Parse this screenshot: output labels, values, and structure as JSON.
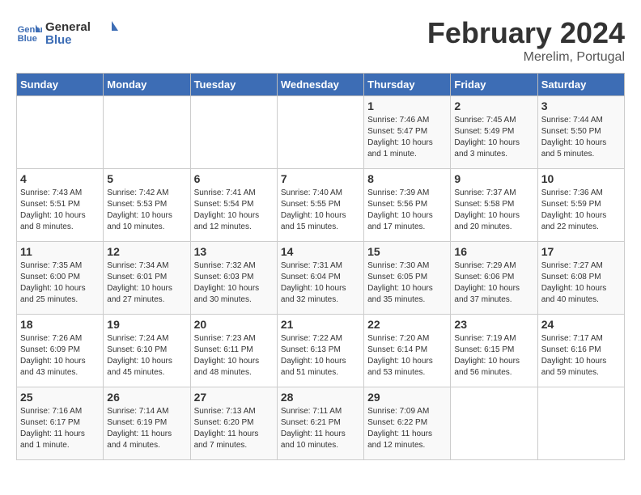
{
  "header": {
    "logo_general": "General",
    "logo_blue": "Blue",
    "month_title": "February 2024",
    "subtitle": "Merelim, Portugal"
  },
  "days_of_week": [
    "Sunday",
    "Monday",
    "Tuesday",
    "Wednesday",
    "Thursday",
    "Friday",
    "Saturday"
  ],
  "weeks": [
    [
      {
        "day": "",
        "info": ""
      },
      {
        "day": "",
        "info": ""
      },
      {
        "day": "",
        "info": ""
      },
      {
        "day": "",
        "info": ""
      },
      {
        "day": "1",
        "info": "Sunrise: 7:46 AM\nSunset: 5:47 PM\nDaylight: 10 hours\nand 1 minute."
      },
      {
        "day": "2",
        "info": "Sunrise: 7:45 AM\nSunset: 5:49 PM\nDaylight: 10 hours\nand 3 minutes."
      },
      {
        "day": "3",
        "info": "Sunrise: 7:44 AM\nSunset: 5:50 PM\nDaylight: 10 hours\nand 5 minutes."
      }
    ],
    [
      {
        "day": "4",
        "info": "Sunrise: 7:43 AM\nSunset: 5:51 PM\nDaylight: 10 hours\nand 8 minutes."
      },
      {
        "day": "5",
        "info": "Sunrise: 7:42 AM\nSunset: 5:53 PM\nDaylight: 10 hours\nand 10 minutes."
      },
      {
        "day": "6",
        "info": "Sunrise: 7:41 AM\nSunset: 5:54 PM\nDaylight: 10 hours\nand 12 minutes."
      },
      {
        "day": "7",
        "info": "Sunrise: 7:40 AM\nSunset: 5:55 PM\nDaylight: 10 hours\nand 15 minutes."
      },
      {
        "day": "8",
        "info": "Sunrise: 7:39 AM\nSunset: 5:56 PM\nDaylight: 10 hours\nand 17 minutes."
      },
      {
        "day": "9",
        "info": "Sunrise: 7:37 AM\nSunset: 5:58 PM\nDaylight: 10 hours\nand 20 minutes."
      },
      {
        "day": "10",
        "info": "Sunrise: 7:36 AM\nSunset: 5:59 PM\nDaylight: 10 hours\nand 22 minutes."
      }
    ],
    [
      {
        "day": "11",
        "info": "Sunrise: 7:35 AM\nSunset: 6:00 PM\nDaylight: 10 hours\nand 25 minutes."
      },
      {
        "day": "12",
        "info": "Sunrise: 7:34 AM\nSunset: 6:01 PM\nDaylight: 10 hours\nand 27 minutes."
      },
      {
        "day": "13",
        "info": "Sunrise: 7:32 AM\nSunset: 6:03 PM\nDaylight: 10 hours\nand 30 minutes."
      },
      {
        "day": "14",
        "info": "Sunrise: 7:31 AM\nSunset: 6:04 PM\nDaylight: 10 hours\nand 32 minutes."
      },
      {
        "day": "15",
        "info": "Sunrise: 7:30 AM\nSunset: 6:05 PM\nDaylight: 10 hours\nand 35 minutes."
      },
      {
        "day": "16",
        "info": "Sunrise: 7:29 AM\nSunset: 6:06 PM\nDaylight: 10 hours\nand 37 minutes."
      },
      {
        "day": "17",
        "info": "Sunrise: 7:27 AM\nSunset: 6:08 PM\nDaylight: 10 hours\nand 40 minutes."
      }
    ],
    [
      {
        "day": "18",
        "info": "Sunrise: 7:26 AM\nSunset: 6:09 PM\nDaylight: 10 hours\nand 43 minutes."
      },
      {
        "day": "19",
        "info": "Sunrise: 7:24 AM\nSunset: 6:10 PM\nDaylight: 10 hours\nand 45 minutes."
      },
      {
        "day": "20",
        "info": "Sunrise: 7:23 AM\nSunset: 6:11 PM\nDaylight: 10 hours\nand 48 minutes."
      },
      {
        "day": "21",
        "info": "Sunrise: 7:22 AM\nSunset: 6:13 PM\nDaylight: 10 hours\nand 51 minutes."
      },
      {
        "day": "22",
        "info": "Sunrise: 7:20 AM\nSunset: 6:14 PM\nDaylight: 10 hours\nand 53 minutes."
      },
      {
        "day": "23",
        "info": "Sunrise: 7:19 AM\nSunset: 6:15 PM\nDaylight: 10 hours\nand 56 minutes."
      },
      {
        "day": "24",
        "info": "Sunrise: 7:17 AM\nSunset: 6:16 PM\nDaylight: 10 hours\nand 59 minutes."
      }
    ],
    [
      {
        "day": "25",
        "info": "Sunrise: 7:16 AM\nSunset: 6:17 PM\nDaylight: 11 hours\nand 1 minute."
      },
      {
        "day": "26",
        "info": "Sunrise: 7:14 AM\nSunset: 6:19 PM\nDaylight: 11 hours\nand 4 minutes."
      },
      {
        "day": "27",
        "info": "Sunrise: 7:13 AM\nSunset: 6:20 PM\nDaylight: 11 hours\nand 7 minutes."
      },
      {
        "day": "28",
        "info": "Sunrise: 7:11 AM\nSunset: 6:21 PM\nDaylight: 11 hours\nand 10 minutes."
      },
      {
        "day": "29",
        "info": "Sunrise: 7:09 AM\nSunset: 6:22 PM\nDaylight: 11 hours\nand 12 minutes."
      },
      {
        "day": "",
        "info": ""
      },
      {
        "day": "",
        "info": ""
      }
    ]
  ]
}
